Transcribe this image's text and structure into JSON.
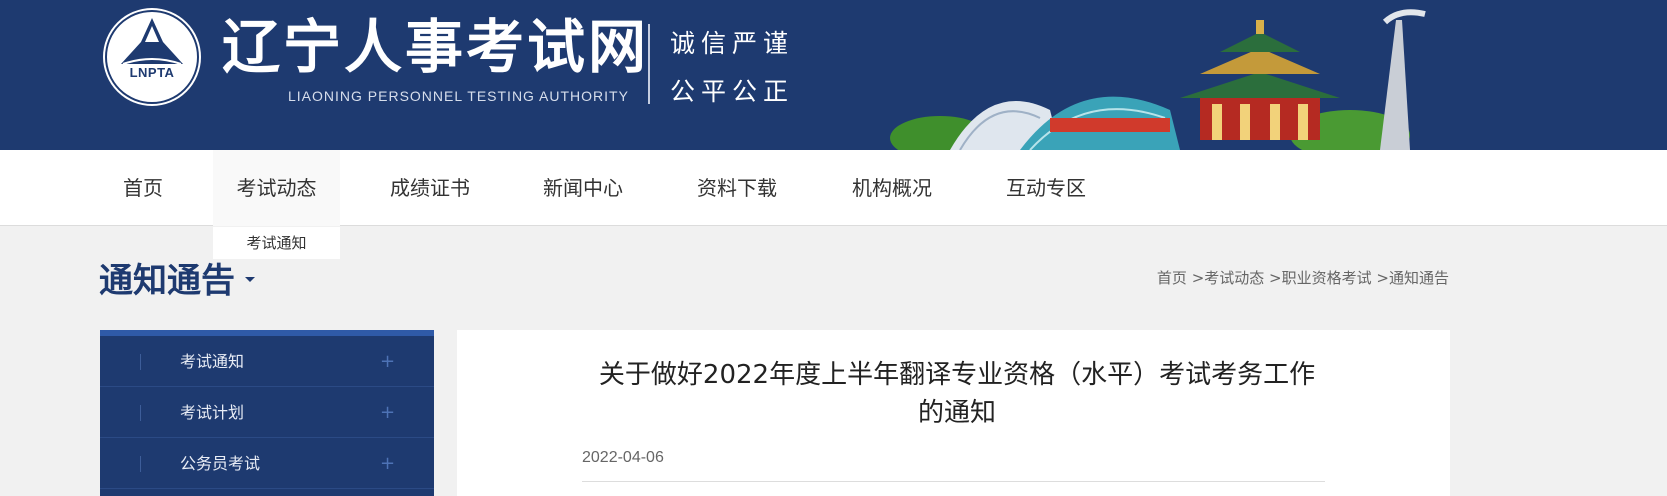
{
  "header": {
    "logo_text": "LNPTA",
    "title": "辽宁人事考试网",
    "subtitle": "LIAONING PERSONNEL TESTING AUTHORITY",
    "motto_line1": "诚信严谨",
    "motto_line2": "公平公正",
    "colors": {
      "primary": "#1e3a70",
      "accent": "#2f5aa8"
    }
  },
  "nav": {
    "items": [
      {
        "label": "首页"
      },
      {
        "label": "考试动态"
      },
      {
        "label": "成绩证书"
      },
      {
        "label": "新闻中心"
      },
      {
        "label": "资料下载"
      },
      {
        "label": "机构概况"
      },
      {
        "label": "互动专区"
      }
    ],
    "active_index": 1,
    "submenu": {
      "label": "考试通知"
    }
  },
  "page": {
    "heading": "通知通告",
    "breadcrumb": {
      "home": "首页",
      "sep": " >",
      "level1": "考试动态",
      "level2": "职业资格考试",
      "level3": "通知通告"
    }
  },
  "sidebar": {
    "items": [
      {
        "label": "考试通知",
        "icon": "plus-icon"
      },
      {
        "label": "考试计划",
        "icon": "plus-icon"
      },
      {
        "label": "公务员考试",
        "icon": "plus-icon"
      }
    ],
    "plus_glyph": "+"
  },
  "article": {
    "title_line1": "关于做好2022年度上半年翻译专业资格（水平）考试考务工作",
    "title_line2": "的通知",
    "date": "2022-04-06"
  }
}
